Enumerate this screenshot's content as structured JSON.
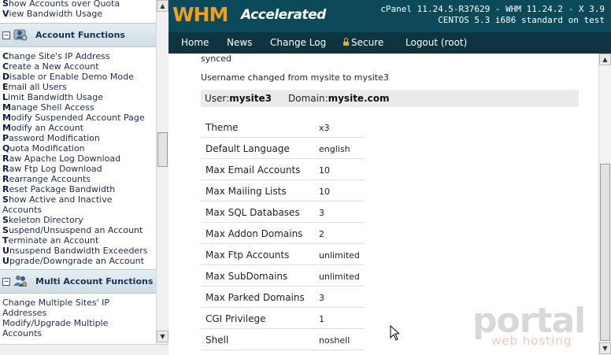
{
  "sidebar": {
    "top_links": [
      {
        "first": "S",
        "rest": "how Accounts over Quota"
      },
      {
        "first": "V",
        "rest": "iew Bandwidth Usage"
      }
    ],
    "account_functions": {
      "toggle": "−",
      "title": "Account Functions",
      "links": [
        {
          "first": "C",
          "rest": "hange Site's IP Address"
        },
        {
          "first": "C",
          "rest": "reate a New Account"
        },
        {
          "first": "D",
          "rest": "isable or Enable Demo Mode"
        },
        {
          "first": "E",
          "rest": "mail all Users"
        },
        {
          "first": "L",
          "rest": "imit Bandwidth Usage"
        },
        {
          "first": "M",
          "rest": "anage Shell Access"
        },
        {
          "first": "M",
          "rest": "odify Suspended Account Page"
        },
        {
          "first": "M",
          "rest": "odify an Account"
        },
        {
          "first": "P",
          "rest": "assword Modification"
        },
        {
          "first": "Q",
          "rest": "uota Modification"
        },
        {
          "first": "R",
          "rest": "aw Apache Log Download"
        },
        {
          "first": "R",
          "rest": "aw Ftp Log Download"
        },
        {
          "first": "R",
          "rest": "earrange Accounts"
        },
        {
          "first": "R",
          "rest": "eset Package Bandwidth"
        },
        {
          "first": "S",
          "rest": "how Active and Inactive"
        },
        {
          "first": "",
          "rest": "Accounts"
        },
        {
          "first": "S",
          "rest": "keleton Directory"
        },
        {
          "first": "S",
          "rest": "uspend/Unsuspend an Account"
        },
        {
          "first": "T",
          "rest": "erminate an Account"
        },
        {
          "first": "U",
          "rest": "nsuspend Bandwidth Exceeders"
        },
        {
          "first": "U",
          "rest": "pgrade/Downgrade an Account"
        }
      ]
    },
    "multi_account_functions": {
      "toggle": "−",
      "title": "Multi Account Functions",
      "links": [
        {
          "first": "",
          "rest": "Change Multiple Sites' IP"
        },
        {
          "first": "",
          "rest": "Addresses"
        },
        {
          "first": "",
          "rest": "Modify/Upgrade Multiple"
        },
        {
          "first": "",
          "rest": "Accounts"
        }
      ]
    }
  },
  "header": {
    "logo_whm": "WHM",
    "logo_accelerated": "Accelerated",
    "version_line1": "cPanel 11.24.5-R37629 - WHM 11.24.2 - X 3.9",
    "version_line2": "CENTOS 5.3 i686 standard on test"
  },
  "nav": {
    "home": "Home",
    "news": "News",
    "changelog": "Change Log",
    "secure": "Secure",
    "logout": "Logout (root)"
  },
  "content": {
    "msg1": "synced",
    "msg2": "Username changed from mysite to mysite3",
    "user_label": "User:",
    "user_value": "mysite3",
    "domain_label": "Domain:",
    "domain_value": "mysite.com",
    "properties": [
      {
        "key": "Theme",
        "value": "x3"
      },
      {
        "key": "Default Language",
        "value": "english"
      },
      {
        "key": "Max Email Accounts",
        "value": "10"
      },
      {
        "key": "Max Mailing Lists",
        "value": "10"
      },
      {
        "key": "Max SQL Databases",
        "value": "3"
      },
      {
        "key": "Max Addon Domains",
        "value": "2"
      },
      {
        "key": "Max Ftp Accounts",
        "value": "unlimited"
      },
      {
        "key": "Max SubDomains",
        "value": "unlimited"
      },
      {
        "key": "Max Parked Domains",
        "value": "3"
      },
      {
        "key": "CGI Privilege",
        "value": "1"
      },
      {
        "key": "Shell",
        "value": "noshell"
      }
    ]
  },
  "watermark": {
    "brand": "portal",
    "tagline": "web hosting"
  },
  "colors": {
    "topbar": "#0c4a5a",
    "navbar": "#0e3440",
    "logo_orange": "#f0a020"
  },
  "icons": {
    "account_functions": "user-gear-icon",
    "multi_account_functions": "users-gear-icon",
    "secure": "lock-icon"
  }
}
